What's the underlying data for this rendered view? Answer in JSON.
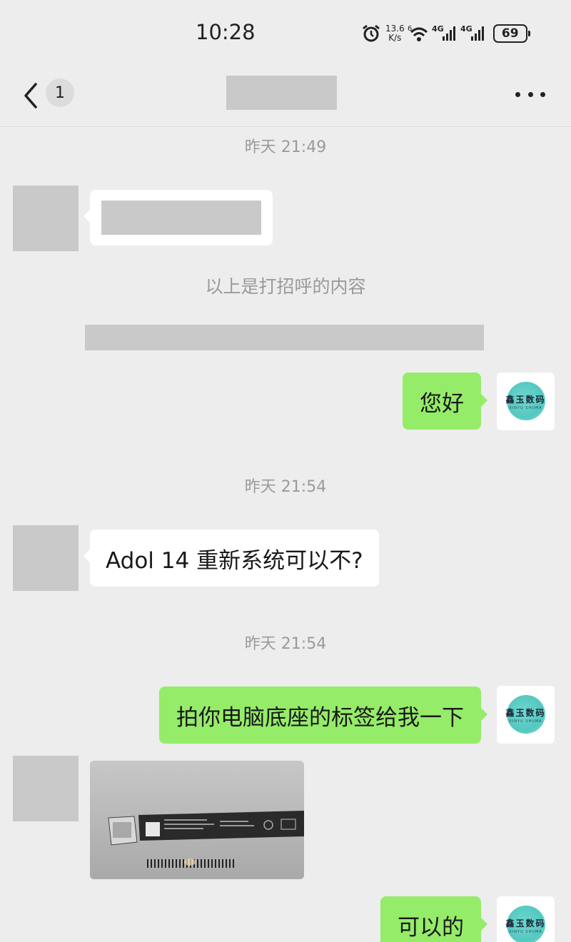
{
  "status_bar": {
    "time": "10:28",
    "net_speed_value": "13.6",
    "net_speed_unit": "K/s",
    "wifi_tag": "6",
    "signal1_label": "4G",
    "signal2_label": "4G",
    "battery": "69",
    "icons": [
      "alarm-icon",
      "wifi-icon",
      "signal-icon",
      "signal-icon",
      "battery-icon"
    ]
  },
  "nav": {
    "back_icon": "chevron-left-icon",
    "unread_count": "1",
    "contact_name": "",
    "more_icon": "more-dots-icon"
  },
  "messages": [
    {
      "type": "timestamp",
      "text": "昨天 21:49"
    },
    {
      "type": "incoming",
      "text": ""
    },
    {
      "type": "system",
      "text": "以上是打招呼的内容"
    },
    {
      "type": "redacted-system",
      "text": ""
    },
    {
      "type": "outgoing",
      "text": "您好"
    },
    {
      "type": "timestamp",
      "text": "昨天 21:54"
    },
    {
      "type": "incoming",
      "text": "Adol 14 重新系统可以不?"
    },
    {
      "type": "timestamp",
      "text": "昨天 21:54"
    },
    {
      "type": "outgoing",
      "text": "拍你电脑底座的标签给我一下"
    },
    {
      "type": "incoming-image",
      "text": ""
    },
    {
      "type": "outgoing",
      "text": "可以的"
    }
  ],
  "shop_avatar": {
    "logo_text": "鑫玉数码",
    "logo_sub": "XINYU SHUMA"
  },
  "colors": {
    "background": "#ededed",
    "outgoing_bubble": "#95ec69",
    "incoming_bubble": "#ffffff",
    "timestamp_text": "#9a9a9a"
  }
}
